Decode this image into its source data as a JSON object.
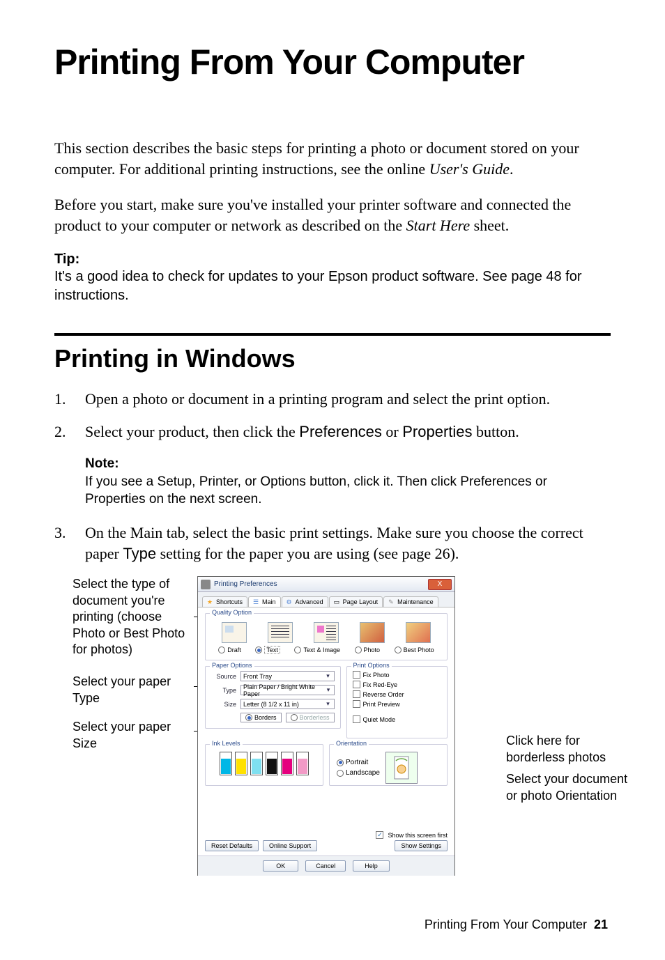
{
  "heading_main": "Printing From Your Computer",
  "intro_para_1_a": "This section describes the basic steps for printing a photo or document stored on your computer. For additional printing instructions, see the online ",
  "intro_para_1_i": "User's Guide",
  "intro_para_1_b": ".",
  "intro_para_2_a": "Before you start, make sure you've installed your printer software and connected the product to your computer or network as described on the ",
  "intro_para_2_i": "Start Here",
  "intro_para_2_b": " sheet.",
  "tip_label": "Tip:",
  "tip_body": "It's a good idea to check for updates to your Epson product software. See page 48 for instructions.",
  "heading_sub": "Printing in Windows",
  "steps": {
    "s1_num": "1.",
    "s1_text": "Open a photo or document in a printing program and select the print option.",
    "s2_num": "2.",
    "s2_text_a": "Select your product, then click the ",
    "s2_text_b": "Preferences",
    "s2_text_c": " or ",
    "s2_text_d": "Properties",
    "s2_text_e": " button.",
    "s3_num": "3.",
    "s3_text_a": "On the Main tab, select the basic print settings. Make sure you choose the correct paper ",
    "s3_text_b": "Type",
    "s3_text_c": " setting for the paper you are using (see page 26)."
  },
  "note_label": "Note:",
  "note_body_a": "If you see a ",
  "note_body_b": "Setup",
  "note_body_c": ", ",
  "note_body_d": "Printer",
  "note_body_e": ", or ",
  "note_body_f": "Options",
  "note_body_g": " button, click it. Then click ",
  "note_body_h": "Preferences",
  "note_body_i": " or ",
  "note_body_j": "Properties",
  "note_body_k": " on the next screen.",
  "callouts": {
    "left1_a": "Select the type of document you're printing (choose ",
    "left1_b": "Photo",
    "left1_c": " or ",
    "left1_d": "Best Photo",
    "left1_e": " for photos)",
    "left2_a": "Select your paper ",
    "left2_b": "Type",
    "left3_a": "Select your paper ",
    "left3_b": "Size",
    "right1": "Click here for borderless photos",
    "right2_a": "Select your document or photo ",
    "right2_b": "Orientation"
  },
  "dialog": {
    "title": "Printing Preferences",
    "close": "X",
    "tabs": {
      "shortcuts": "Shortcuts",
      "main": "Main",
      "advanced": "Advanced",
      "page_layout": "Page Layout",
      "maintenance": "Maintenance"
    },
    "groups": {
      "quality": "Quality Option",
      "paper": "Paper Options",
      "print": "Print Options",
      "ink": "Ink Levels",
      "orientation": "Orientation"
    },
    "quality": {
      "draft": "Draft",
      "text": "Text",
      "text_image": "Text & Image",
      "photo": "Photo",
      "best_photo": "Best Photo"
    },
    "paper": {
      "source_label": "Source",
      "source_value": "Front Tray",
      "type_label": "Type",
      "type_value": "Plain Paper / Bright White Paper",
      "size_label": "Size",
      "size_value": "Letter (8 1/2 x 11 in)",
      "borders": "Borders",
      "borderless": "Borderless"
    },
    "print": {
      "fix_photo": "Fix Photo",
      "fix_red_eye": "Fix Red-Eye",
      "reverse_order": "Reverse Order",
      "print_preview": "Print Preview",
      "quiet_mode": "Quiet Mode"
    },
    "orientation": {
      "portrait": "Portrait",
      "landscape": "Landscape"
    },
    "footer": {
      "show_first": "Show this screen first",
      "reset": "Reset Defaults",
      "online": "Online Support",
      "show_settings": "Show Settings",
      "ok": "OK",
      "cancel": "Cancel",
      "help": "Help"
    }
  },
  "page_footer_text": "Printing From Your Computer",
  "page_number": "21"
}
